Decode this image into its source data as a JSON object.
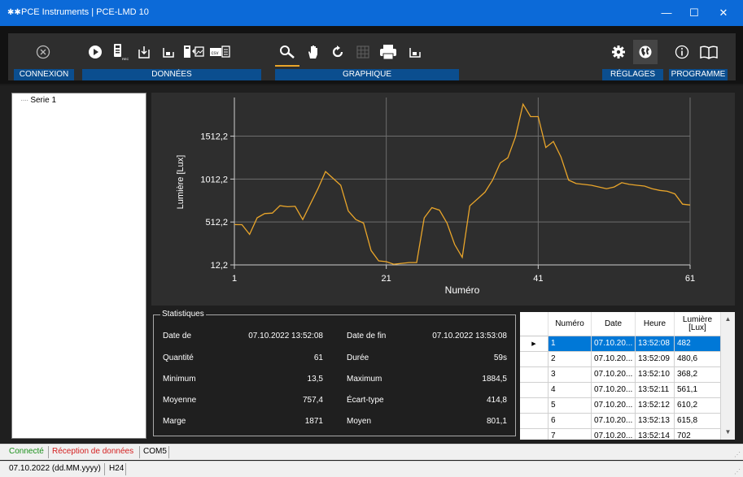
{
  "window": {
    "title": "PCE Instruments | PCE-LMD 10",
    "icon_name": "pce-logo-icon",
    "controls": {
      "minimize": "—",
      "maximize": "☐",
      "close": "✕"
    }
  },
  "toolbar": {
    "groups": {
      "connexion": "CONNEXION",
      "donnees": "DONNÉES",
      "graphique": "GRAPHIQUE",
      "reglages": "RÉGLAGES",
      "programme": "PROGRAMME"
    },
    "active_tool": "zoom-icon",
    "accent_color": "#e9a52a"
  },
  "tree": {
    "items": [
      "Serie 1"
    ]
  },
  "chart_data": {
    "type": "line",
    "xlabel": "Numéro",
    "ylabel": "Lumière [Lux]",
    "x_ticks": [
      "1",
      "21",
      "41",
      "61"
    ],
    "y_ticks": [
      "12,2",
      "512,2",
      "1012,2",
      "1512,2"
    ],
    "xlim": [
      1,
      61
    ],
    "ylim": [
      12.2,
      1962.2
    ],
    "grid": true,
    "line_color": "#e9a52a",
    "series": [
      {
        "values": [
          482,
          480.6,
          368.2,
          561.1,
          610.2,
          615.8,
          702,
          690,
          695,
          540,
          720,
          900,
          1100,
          1020,
          940,
          640,
          540,
          500,
          180,
          60,
          50,
          20,
          30,
          40,
          40,
          560,
          680,
          650,
          500,
          250,
          100,
          700,
          780,
          860,
          1000,
          1200,
          1260,
          1500,
          1884.5,
          1740,
          1740,
          1380,
          1450,
          1270,
          1000,
          960,
          950,
          940,
          920,
          900,
          920,
          970,
          950,
          940,
          930,
          900,
          880,
          870,
          840,
          720,
          710
        ]
      }
    ]
  },
  "stats": {
    "legend": "Statistiques",
    "rows": [
      {
        "l1": "Date de",
        "v1": "07.10.2022 13:52:08",
        "l2": "Date de fin",
        "v2": "07.10.2022 13:53:08"
      },
      {
        "l1": "Quantité",
        "v1": "61",
        "l2": "Durée",
        "v2": "59s"
      },
      {
        "l1": "Minimum",
        "v1": "13,5",
        "l2": "Maximum",
        "v2": "1884,5"
      },
      {
        "l1": "Moyenne",
        "v1": "757,4",
        "l2": "Écart-type",
        "v2": "414,8"
      },
      {
        "l1": "Marge",
        "v1": "1871",
        "l2": "Moyen",
        "v2": "801,1"
      }
    ]
  },
  "table": {
    "headers": [
      "Numéro",
      "Date",
      "Heure",
      "Lumière [Lux]"
    ],
    "rows": [
      [
        "1",
        "07.10.20...",
        "13:52:08",
        "482"
      ],
      [
        "2",
        "07.10.20...",
        "13:52:09",
        "480,6"
      ],
      [
        "3",
        "07.10.20...",
        "13:52:10",
        "368,2"
      ],
      [
        "4",
        "07.10.20...",
        "13:52:11",
        "561,1"
      ],
      [
        "5",
        "07.10.20...",
        "13:52:12",
        "610,2"
      ],
      [
        "6",
        "07.10.20...",
        "13:52:13",
        "615,8"
      ],
      [
        "7",
        "07.10.20...",
        "13:52:14",
        "702"
      ]
    ],
    "selected_index": 0,
    "selection_color": "#0078d7"
  },
  "status": {
    "connected": "Connecté",
    "connected_color": "#1a8f1a",
    "reception": "Réception de données",
    "reception_color": "#d42020",
    "port": "COM5",
    "date_format": "07.10.2022 (dd.MM.yyyy)",
    "time_format": "H24"
  }
}
